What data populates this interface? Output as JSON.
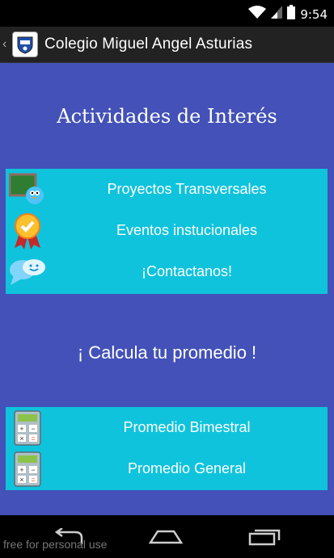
{
  "status_bar": {
    "time": "9:54",
    "icons": [
      "wifi-icon",
      "signal-icon",
      "battery-icon"
    ]
  },
  "action_bar": {
    "title": "Colegio Miguel Angel Asturias",
    "logo": "school-logo-icon",
    "back": "back-chevron-icon"
  },
  "section1": {
    "heading": "Actividades de Interés",
    "items": [
      {
        "label": "Proyectos Transversales",
        "icon": "bird-chalkboard-icon"
      },
      {
        "label": "Eventos instucionales",
        "icon": "award-medal-icon"
      },
      {
        "label": "¡Contactanos!",
        "icon": "speech-bubbles-icon"
      }
    ]
  },
  "section2": {
    "heading": "¡ Calcula tu promedio !",
    "items": [
      {
        "label": "Promedio Bimestral",
        "icon": "calculator-icon"
      },
      {
        "label": "Promedio General",
        "icon": "calculator-icon"
      }
    ]
  },
  "nav_bar": {
    "buttons": [
      "back-icon",
      "home-icon",
      "recent-apps-icon"
    ]
  },
  "watermark": "free for personal use",
  "colors": {
    "content_bg": "#4351b8",
    "panel_bg": "#0fc3dc",
    "action_bar_bg": "#222222"
  }
}
